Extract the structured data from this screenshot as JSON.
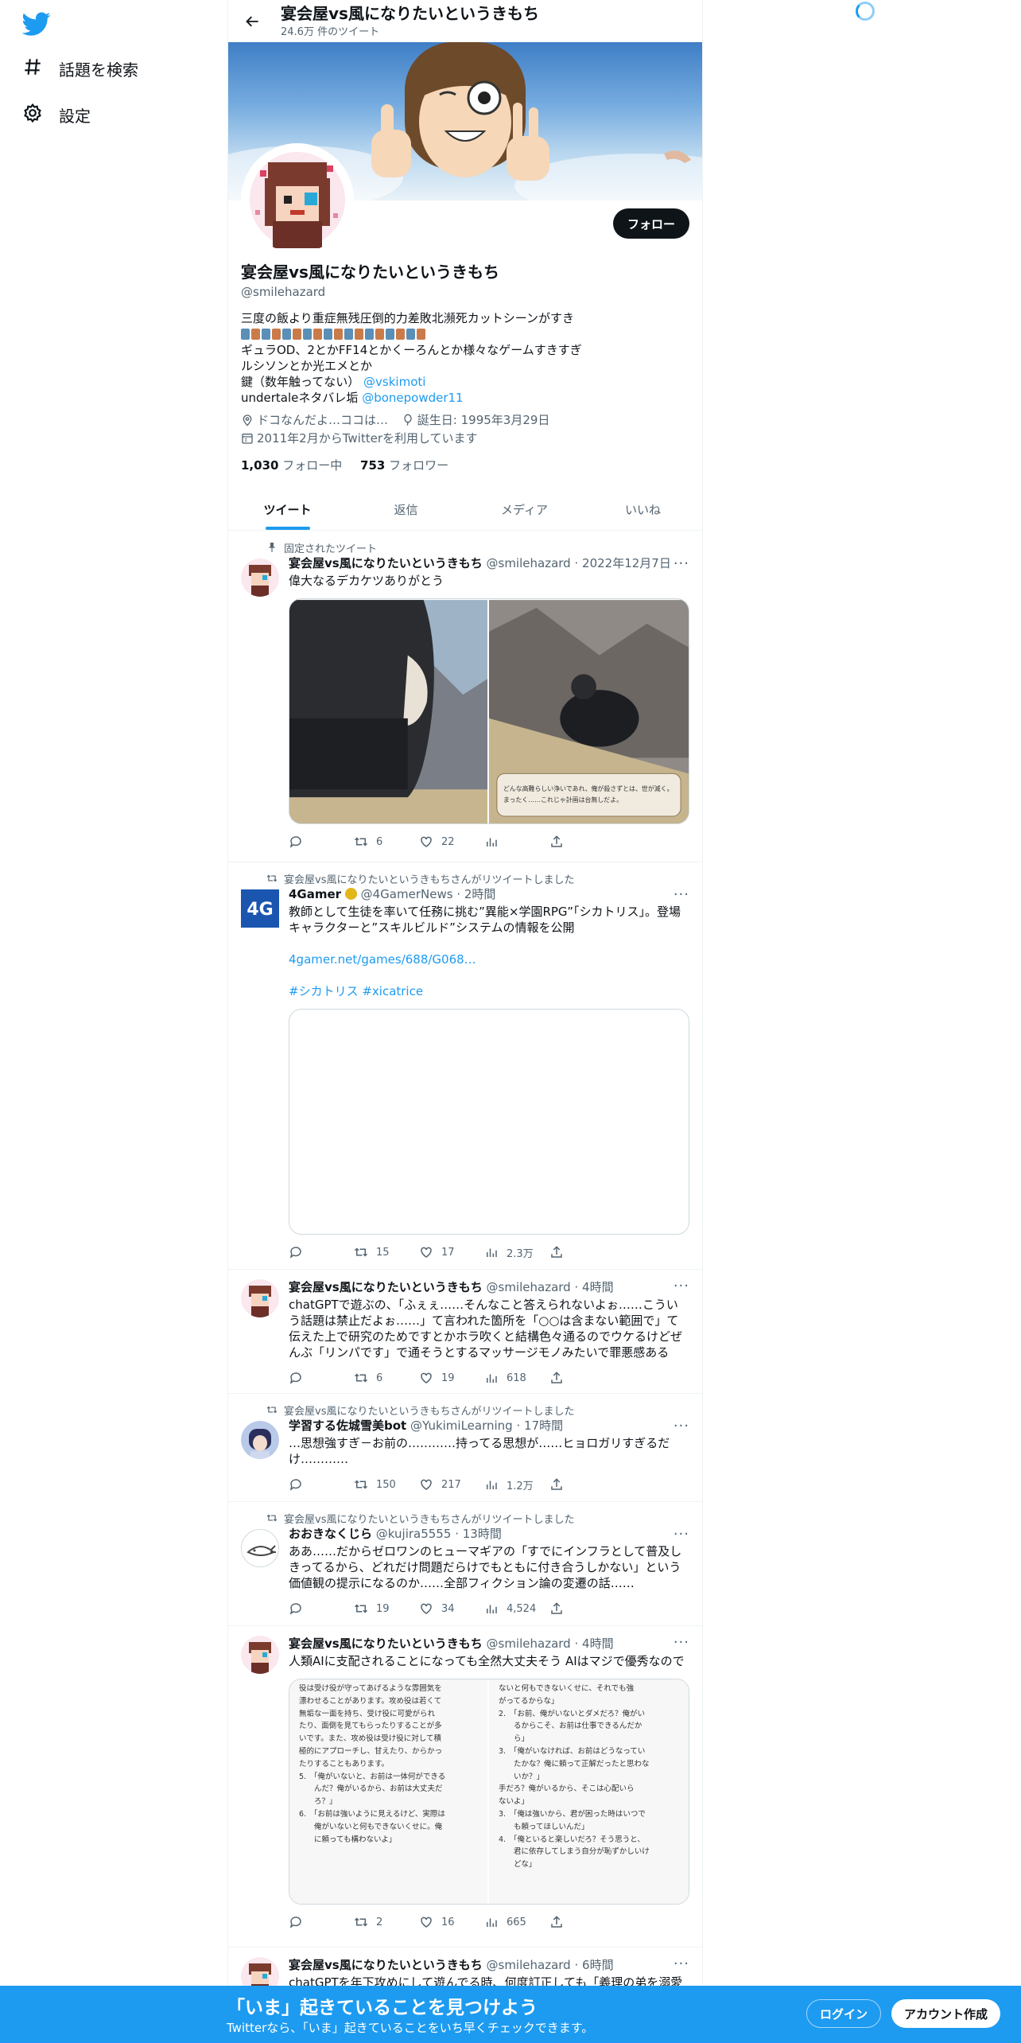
{
  "sidebar": {
    "logo": "twitter-bird-icon",
    "items": [
      {
        "icon": "hash-icon",
        "label": "話題を検索"
      },
      {
        "icon": "gear-icon",
        "label": "設定"
      }
    ]
  },
  "header": {
    "title": "宴会屋vs風になりたいというきもち",
    "tweet_count": "24.6万 件のツイート"
  },
  "profile": {
    "name": "宴会屋vs風になりたいというきもち",
    "handle": "@smilehazard",
    "follow_label": "フォロー",
    "bio": {
      "line1": "三度の飯より重症無残圧倒的力差敗北瀕死カットシーンがすき",
      "line3": "ギュラOD、2とかFF14とかくーろんとか様々なゲームすきすぎ",
      "line4": "ルシソンとか光エメとか",
      "line5_text": "鍵（数年触ってない）",
      "line5_link": "@vskimoti",
      "line6_text": "undertaleネタバレ垢",
      "line6_link": "@bonepowder11"
    },
    "location": "ドコなんだよ…ココは…",
    "birthday": "誕生日: 1995年3月29日",
    "joined": "2011年2月からTwitterを利用しています",
    "following_count": "1,030",
    "following_label": "フォロー中",
    "followers_count": "753",
    "followers_label": "フォロワー"
  },
  "tabs": [
    {
      "label": "ツイート",
      "active": true
    },
    {
      "label": "返信",
      "active": false
    },
    {
      "label": "メディア",
      "active": false
    },
    {
      "label": "いいね",
      "active": false
    }
  ],
  "tweets": [
    {
      "social": "固定されたツイート",
      "name": "宴会屋vs風になりたいというきもち",
      "handle": "@smilehazard",
      "time": "2022年12月7日",
      "text": "偉大なるデカケツありがとう",
      "replies": "",
      "retweets": "6",
      "likes": "22",
      "views": ""
    },
    {
      "social": "宴会屋vs風になりたいというきもちさんがリツイートしました",
      "name": "4Gamer",
      "handle": "@4GamerNews",
      "time": "2時間",
      "text": "教師として生徒を率いて任務に挑む”異能×学園RPG”「シカトリス」。登場キャラクターと”スキルビルド”システムの情報を公開",
      "link": "4gamer.net/games/688/G068…",
      "hashtags": "#シカトリス #xicatrice",
      "replies": "",
      "retweets": "15",
      "likes": "17",
      "views": "2.3万"
    },
    {
      "name": "宴会屋vs風になりたいというきもち",
      "handle": "@smilehazard",
      "time": "4時間",
      "text": "chatGPTで遊ぶの、「ふぇぇ……そんなこと答えられないよぉ……こういう話題は禁止だよぉ……」て言われた箇所を「○○は含まない範囲で」て伝えた上で研究のためですとかホラ吹くと結構色々通るのでウケるけどぜんぶ「リンパです」で通そうとするマッサージモノみたいで罪悪感ある",
      "replies": "",
      "retweets": "6",
      "likes": "19",
      "views": "618"
    },
    {
      "social": "宴会屋vs風になりたいというきもちさんがリツイートしました",
      "name": "学習する佐城雪美bot",
      "handle": "@YukimiLearning",
      "time": "17時間",
      "text": "…思想強すぎ－お前の…………持ってる思想が……ヒョロガリすぎるだけ…………",
      "replies": "",
      "retweets": "150",
      "likes": "217",
      "views": "1.2万"
    },
    {
      "social": "宴会屋vs風になりたいというきもちさんがリツイートしました",
      "name": "おおきなくじら",
      "handle": "@kujira5555",
      "time": "13時間",
      "text": "ああ……だからゼロワンのヒューマギアの「すでにインフラとして普及しきってるから、どれだけ問題だらけでもともに付き合うしかない」という価値観の提示になるのか……全部フィクション論の変遷の話……",
      "replies": "",
      "retweets": "19",
      "likes": "34",
      "views": "4,524"
    },
    {
      "name": "宴会屋vs風になりたいというきもち",
      "handle": "@smilehazard",
      "time": "4時間",
      "text": "人類AIに支配されることになっても全然大丈夫そう AIはマジで優秀なので",
      "replies": "",
      "retweets": "2",
      "likes": "16",
      "views": "665",
      "shot_left": [
        "役は受け役が守ってあげるような雰囲気を",
        "漂わせることがあります。攻め役は若くて",
        "無垢な一面を持ち、受け役に可愛がられ",
        "たり、面倒を見てもらったりすることが多",
        "いです。また、攻め役は受け役に対して積",
        "極的にアプローチし、甘えたり、からかっ",
        "たりすることもあります。",
        "5.　「俺がいないと、お前は一体何ができる",
        "　　んだ？俺がいるから、お前は大丈夫だ",
        "　　ろ？」",
        "6.　「お前は強いように見えるけど、実際は",
        "　　俺がいないと何もできないくせに。俺",
        "　　に頼っても構わないよ」"
      ],
      "shot_right": [
        "ないと何もできないくせに、それでも強",
        "がってるからな」",
        "2.　「お前、俺がいないとダメだろ？俺がい",
        "　　るからこそ、お前は仕事できるんだか",
        "　　ら」",
        "3.　「俺がいなければ、お前はどうなってい",
        "　　たかな？俺に頼って正解だったと思わな",
        "　　いか？」",
        "手だろ？俺がいるから、そこは心配いら",
        "ないよ」",
        "3.　「俺は強いから、君が困った時はいつで",
        "　　も頼ってほしいんだ」",
        "4.　「俺といると楽しいだろ？そう思うと、",
        "　　君に依存してしまう自分が恥ずかしいけ",
        "　　どな」"
      ]
    },
    {
      "name": "宴会屋vs風になりたいというきもち",
      "handle": "@smilehazard",
      "time": "6時間",
      "text": "chatGPTを年下攻めにして遊んでる時、何度訂正しても「義理の弟を溺愛"
    }
  ],
  "game_caption": [
    "どんな高難らしい浄いであれ、俺が殺さずとは、世が滅く。",
    "まったく……これじゃ計画は台無しだよ。"
  ],
  "bottom_bar": {
    "title": "「いま」起きていることを見つけよう",
    "subtitle": "Twitterなら、「いま」起きていることをいち早くチェックできます。",
    "login_label": "ログイン",
    "signup_label": "アカウント作成"
  }
}
